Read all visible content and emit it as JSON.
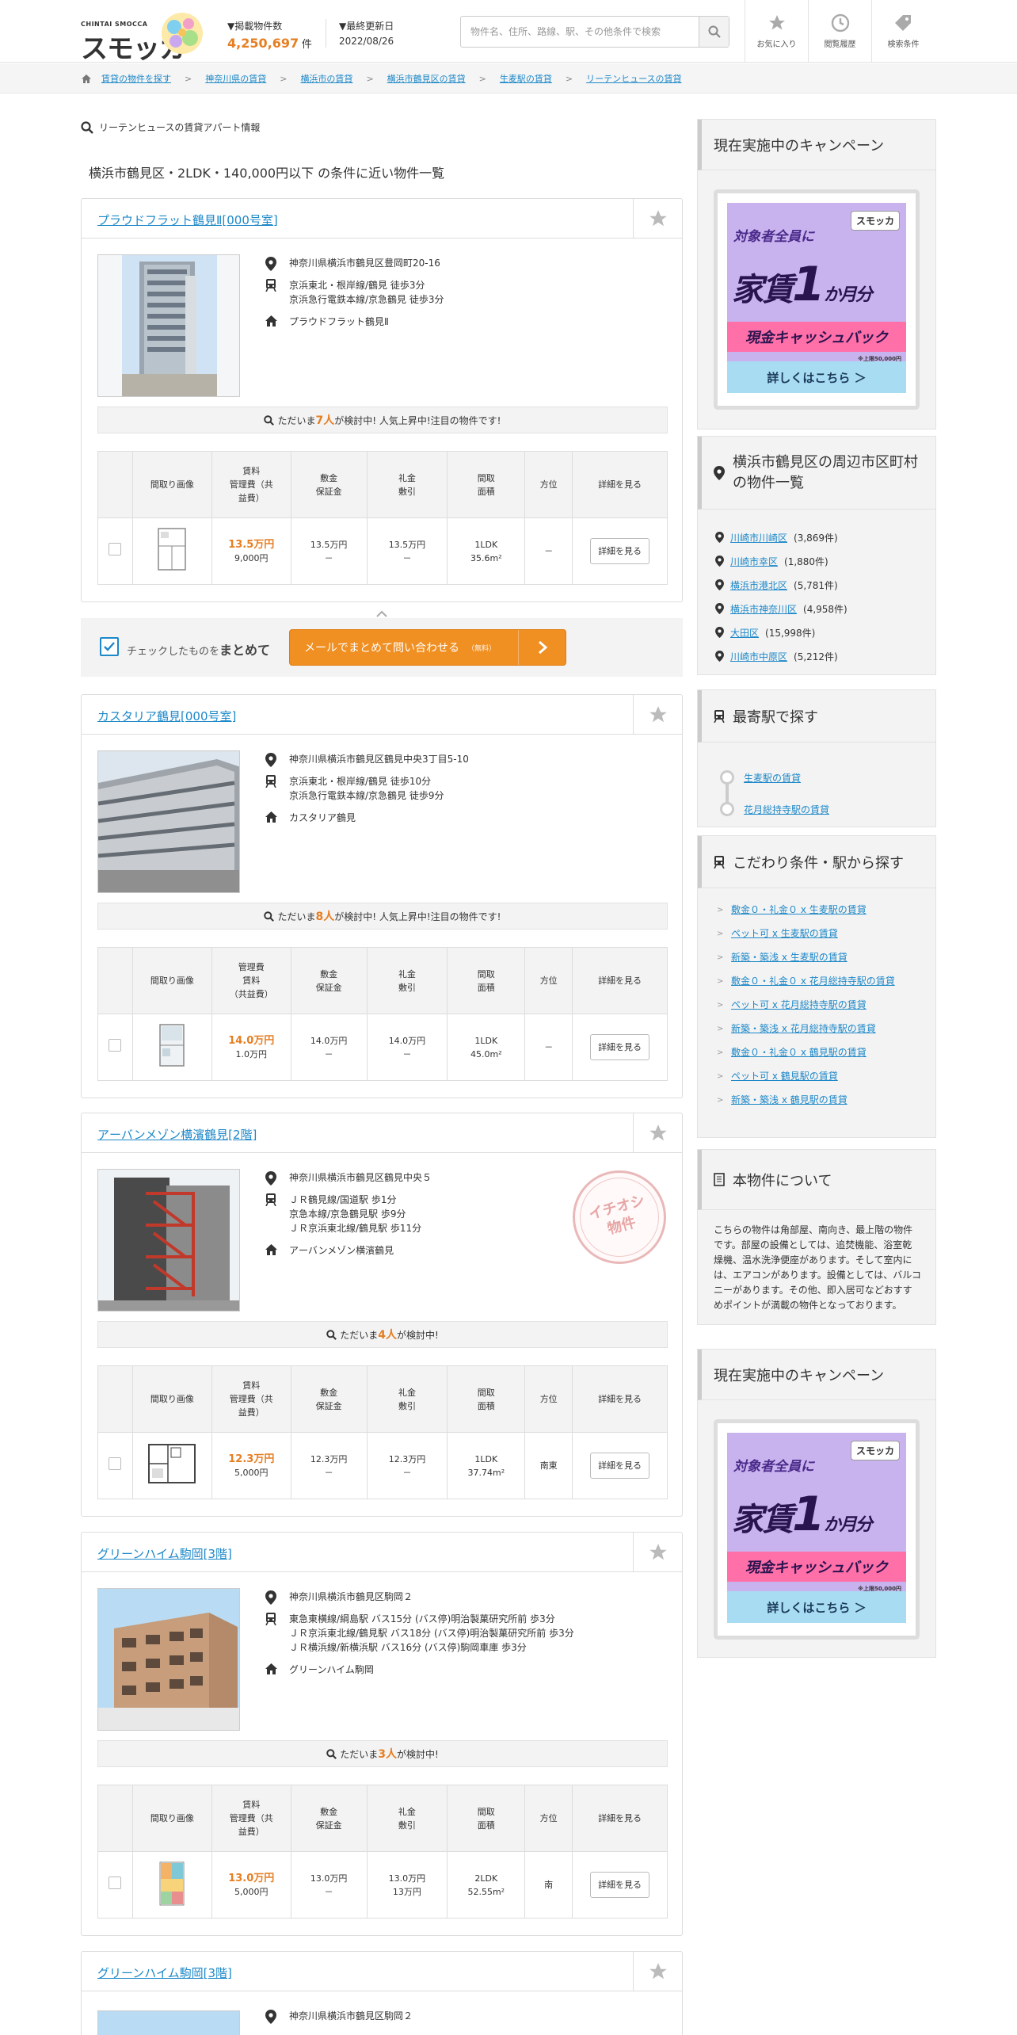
{
  "header": {
    "logo_small": "CHINTAI SMOCCA",
    "logo_text": "スモッカ",
    "count_label": "▼掲載物件数",
    "count_value": "4,250,697",
    "count_unit": "件",
    "updated_label": "▼最終更新日",
    "updated_value": "2022/08/26",
    "search_placeholder": "物件名、住所、路線、駅、その他条件で検索",
    "btn_favorite": "お気に入り",
    "btn_history": "閲覧履歴",
    "btn_conditions": "検索条件"
  },
  "breadcrumb": [
    "賃貸の物件を探す",
    "神奈川県の賃貸",
    "横浜市の賃貸",
    "横浜市鶴見区の賃貸",
    "生麦駅の賃貸",
    "リーテンヒュースの賃貸"
  ],
  "main": {
    "search_title": "リーテンヒュースの賃貸アパート情報",
    "cond_title": "横浜市鶴見区・2LDK・140,000円以下 の条件に近い物件一覧",
    "table_headers": [
      "間取り画像",
      "賃料\n管理費（共益費）",
      "敷金\n保証金",
      "礼金\n敷引",
      "間取\n面積",
      "方位",
      "詳細を見る"
    ],
    "detail_label": "詳細を見る",
    "inquiry": {
      "check_text": "チェックしたものを",
      "check_bold": "まとめて",
      "button_text": "メールでまとめて問い合わせる",
      "free": "（無料）"
    },
    "properties": [
      {
        "title": "プラウドフラット鶴見Ⅱ[000号室]",
        "address": "神奈川県横浜市鶴見区豊岡町20-16",
        "access": [
          "京浜東北・根岸線/鶴見 徒歩3分",
          "京浜急行電鉄本線/京急鶴見 徒歩3分"
        ],
        "building": "プラウドフラット鶴見Ⅱ",
        "pop_pre": "ただいま",
        "pop_num": "7人",
        "pop_post": "が検討中! 人気上昇中!注目の物件です!",
        "rent": "13.5万円",
        "fee": "9,000円",
        "deposit": "13.5万円",
        "deposit2": "－",
        "key": "13.5万円",
        "key2": "－",
        "layout": "1LDK",
        "area": "35.6m²",
        "direction": "－"
      },
      {
        "title": "カスタリア鶴見[000号室]",
        "address": "神奈川県横浜市鶴見区鶴見中央3丁目5-10",
        "access": [
          "京浜東北・根岸線/鶴見 徒歩10分",
          "京浜急行電鉄本線/京急鶴見 徒歩9分"
        ],
        "building": "カスタリア鶴見",
        "pop_pre": "ただいま",
        "pop_num": "8人",
        "pop_post": "が検討中! 人気上昇中!注目の物件です!",
        "rent": "14.0万円",
        "fee": "1.0万円",
        "deposit": "14.0万円",
        "deposit2": "－",
        "key": "14.0万円",
        "key2": "－",
        "layout": "1LDK",
        "area": "45.0m²",
        "direction": "－"
      },
      {
        "title": "アーバンメゾン横濱鶴見[2階]",
        "address": "神奈川県横浜市鶴見区鶴見中央５",
        "access": [
          "ＪＲ鶴見線/国道駅 歩1分",
          "京急本線/京急鶴見駅 歩9分",
          "ＪＲ京浜東北線/鶴見駅 歩11分"
        ],
        "building": "アーバンメゾン横濱鶴見",
        "stamp": "イチオシ物件",
        "pop_pre": "ただいま",
        "pop_num": "4人",
        "pop_post": "が検討中!",
        "rent": "12.3万円",
        "fee": "5,000円",
        "deposit": "12.3万円",
        "deposit2": "－",
        "key": "12.3万円",
        "key2": "－",
        "layout": "1LDK",
        "area": "37.74m²",
        "direction": "南東"
      },
      {
        "title": "グリーンハイム駒岡[3階]",
        "address": "神奈川県横浜市鶴見区駒岡２",
        "access": [
          "東急東横線/綱島駅 バス15分 (バス停)明治製菓研究所前 歩3分",
          "ＪＲ京浜東北線/鶴見駅 バス18分 (バス停)明治製菓研究所前 歩3分",
          "ＪＲ横浜線/新横浜駅 バス16分 (バス停)駒岡車庫 歩3分"
        ],
        "building": "グリーンハイム駒岡",
        "pop_pre": "ただいま",
        "pop_num": "3人",
        "pop_post": "が検討中!",
        "rent": "13.0万円",
        "fee": "5,000円",
        "deposit": "13.0万円",
        "deposit2": "－",
        "key": "13.0万円",
        "key2": "13万円",
        "layout": "2LDK",
        "area": "52.55m²",
        "direction": "南"
      },
      {
        "title": "グリーンハイム駒岡[3階]",
        "address": "神奈川県横浜市鶴見区駒岡２"
      }
    ]
  },
  "sidebar": {
    "campaign_title": "現在実施中のキャンペーン",
    "banner": {
      "line1": "対象者全員に",
      "brand": "スモッカ",
      "line2_a": "家賃",
      "line2_b": "1",
      "line2_c": "か月分",
      "line3": "現金キャッシュバック",
      "note": "※上限50,000円",
      "cta": "詳しくはこちら ＞"
    },
    "nearby_title": "横浜市鶴見区の周辺市区町村の物件一覧",
    "nearby": [
      {
        "name": "川崎市川崎区",
        "count": "(3,869件)"
      },
      {
        "name": "川崎市幸区",
        "count": "(1,880件)"
      },
      {
        "name": "横浜市港北区",
        "count": "(5,781件)"
      },
      {
        "name": "横浜市神奈川区",
        "count": "(4,958件)"
      },
      {
        "name": "大田区",
        "count": "(15,998件)"
      },
      {
        "name": "川崎市中原区",
        "count": "(5,212件)"
      }
    ],
    "station_title": "最寄駅で探す",
    "stations": [
      "生麦駅の賃貸",
      "花月総持寺駅の賃貸"
    ],
    "kodawari_title": "こだわり条件・駅から探す",
    "kodawari": [
      "敷金０・礼金０ x 生麦駅の賃貸",
      "ペット可 x 生麦駅の賃貸",
      "新築・築浅 x 生麦駅の賃貸",
      "敷金０・礼金０ x 花月総持寺駅の賃貸",
      "ペット可 x 花月総持寺駅の賃貸",
      "新築・築浅 x 花月総持寺駅の賃貸",
      "敷金０・礼金０ x 鶴見駅の賃貸",
      "ペット可 x 鶴見駅の賃貸",
      "新築・築浅 x 鶴見駅の賃貸"
    ],
    "about_title": "本物件について",
    "about_text": "こちらの物件は角部屋、南向き、最上階の物件です。部屋の設備としては、追焚機能、浴室乾燥機、温水洗浄便座があります。そして室内には、エアコンがあります。設備としては、バルコニーがあります。その他、即入居可などおすすめポイントが満載の物件となっております。"
  },
  "colors": {
    "link": "#1e88c8",
    "accent": "#e67e22",
    "button_orange": "#f08f22",
    "panel_gray": "#f3f3f3"
  }
}
